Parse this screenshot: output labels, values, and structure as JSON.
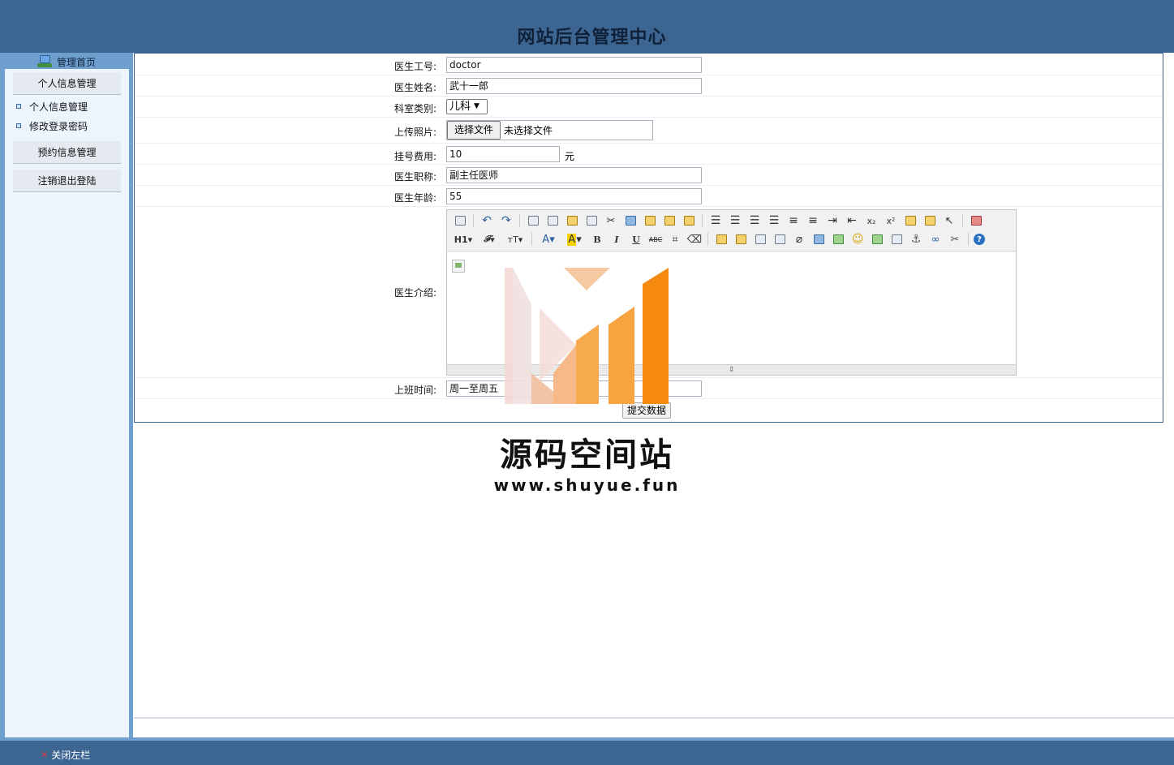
{
  "header": {
    "title": "网站后台管理中心"
  },
  "sidebar": {
    "home_label": "管理首页",
    "sections": [
      {
        "label": "个人信息管理"
      },
      {
        "label": "预约信息管理"
      },
      {
        "label": "注销退出登陆"
      }
    ],
    "sub_items": [
      {
        "label": "个人信息管理"
      },
      {
        "label": "修改登录密码"
      }
    ]
  },
  "form": {
    "doctor_id": {
      "label": "医生工号:",
      "value": "doctor"
    },
    "doctor_name": {
      "label": "医生姓名:",
      "value": "武十一郎"
    },
    "department": {
      "label": "科室类别:",
      "value": "儿科"
    },
    "photo": {
      "label": "上传照片:",
      "button": "选择文件",
      "status": "未选择文件"
    },
    "fee": {
      "label": "挂号费用:",
      "value": "10",
      "unit": "元"
    },
    "title": {
      "label": "医生职称:",
      "value": "副主任医师"
    },
    "age": {
      "label": "医生年龄:",
      "value": "55"
    },
    "intro": {
      "label": "医生介绍:"
    },
    "work_time": {
      "label": "上班时间:",
      "value": "周一至周五"
    },
    "submit": "提交数据"
  },
  "editor": {
    "toolbar_row2_text": {
      "heading": "H1",
      "font": "𝓕",
      "size": "тT",
      "fontcolor": "A",
      "bgcolor": "A",
      "bold": "B",
      "italic": "I",
      "underline": "U",
      "strike": "ABC"
    }
  },
  "footer": {
    "close_left": "关闭左栏"
  },
  "watermark": {
    "title": "源码空间站",
    "url": "www.shuyue.fun"
  },
  "colors": {
    "header_bg": "#3d6592",
    "sidebar_bg": "#ecf5fd",
    "sidebar_frame": "#6f9fcf"
  }
}
